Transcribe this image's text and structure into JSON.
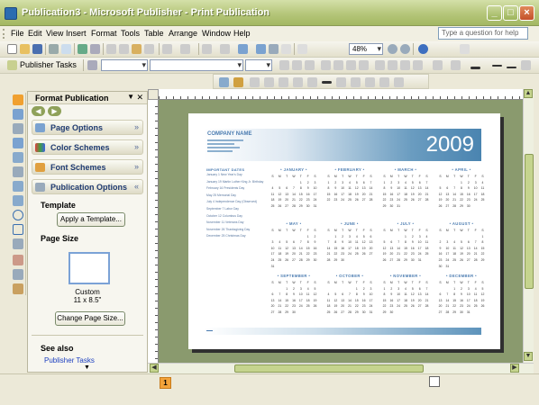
{
  "window": {
    "title": "Publication3 - Microsoft Publisher - Print Publication"
  },
  "menubar": {
    "items": [
      "File",
      "Edit",
      "View",
      "Insert",
      "Format",
      "Tools",
      "Table",
      "Arrange",
      "Window",
      "Help"
    ],
    "help_placeholder": "Type a question for help"
  },
  "toolbar": {
    "zoom": "48%",
    "publisher_tasks": "Publisher Tasks"
  },
  "task_pane": {
    "title": "Format Publication",
    "sections": [
      {
        "label": "Page Options",
        "icon": "page-options-icon",
        "chevron": "»"
      },
      {
        "label": "Color Schemes",
        "icon": "color-schemes-icon",
        "chevron": "»"
      },
      {
        "label": "Font Schemes",
        "icon": "font-schemes-icon",
        "chevron": "»"
      },
      {
        "label": "Publication Options",
        "icon": "publication-options-icon",
        "chevron": "«"
      }
    ],
    "template_heading": "Template",
    "apply_template_button": "Apply a Template...",
    "page_size_heading": "Page Size",
    "page_size_name": "Custom",
    "page_size_dims": "11 x 8.5\"",
    "change_page_size_button": "Change Page Size...",
    "see_also": "See also",
    "see_also_link": "Publisher Tasks"
  },
  "document": {
    "company": "COMPANY NAME",
    "year": "2009",
    "holidays_title": "IMPORTANT DATES",
    "holidays": [
      "January 1 New Year's Day",
      "January 19 Martin Luther King Jr. Birthday",
      "February 16 Presidents Day",
      "May 25 Memorial Day",
      "July 4 Independence Day (Observed)",
      "September 7 Labor Day",
      "October 12 Columbus Day",
      "November 11 Veterans Day",
      "November 26 Thanksgiving Day",
      "December 25 Christmas Day"
    ],
    "months": [
      {
        "name": "JANUARY",
        "first_day": 4,
        "days": 31
      },
      {
        "name": "FEBRUARY",
        "first_day": 0,
        "days": 28
      },
      {
        "name": "MARCH",
        "first_day": 0,
        "days": 31
      },
      {
        "name": "APRIL",
        "first_day": 3,
        "days": 30
      },
      {
        "name": "MAY",
        "first_day": 5,
        "days": 31
      },
      {
        "name": "JUNE",
        "first_day": 1,
        "days": 30
      },
      {
        "name": "JULY",
        "first_day": 3,
        "days": 31
      },
      {
        "name": "AUGUST",
        "first_day": 6,
        "days": 31
      },
      {
        "name": "SEPTEMBER",
        "first_day": 2,
        "days": 30
      },
      {
        "name": "OCTOBER",
        "first_day": 4,
        "days": 31
      },
      {
        "name": "NOVEMBER",
        "first_day": 0,
        "days": 30
      },
      {
        "name": "DECEMBER",
        "first_day": 2,
        "days": 31
      }
    ],
    "weekday_letters": [
      "S",
      "M",
      "T",
      "W",
      "T",
      "F",
      "S"
    ]
  },
  "status": {
    "page_number": "1"
  },
  "colors": {
    "accent": "#4a7bb0",
    "titlebar": "#b5c67a",
    "page_indicator": "#f3a33a"
  }
}
